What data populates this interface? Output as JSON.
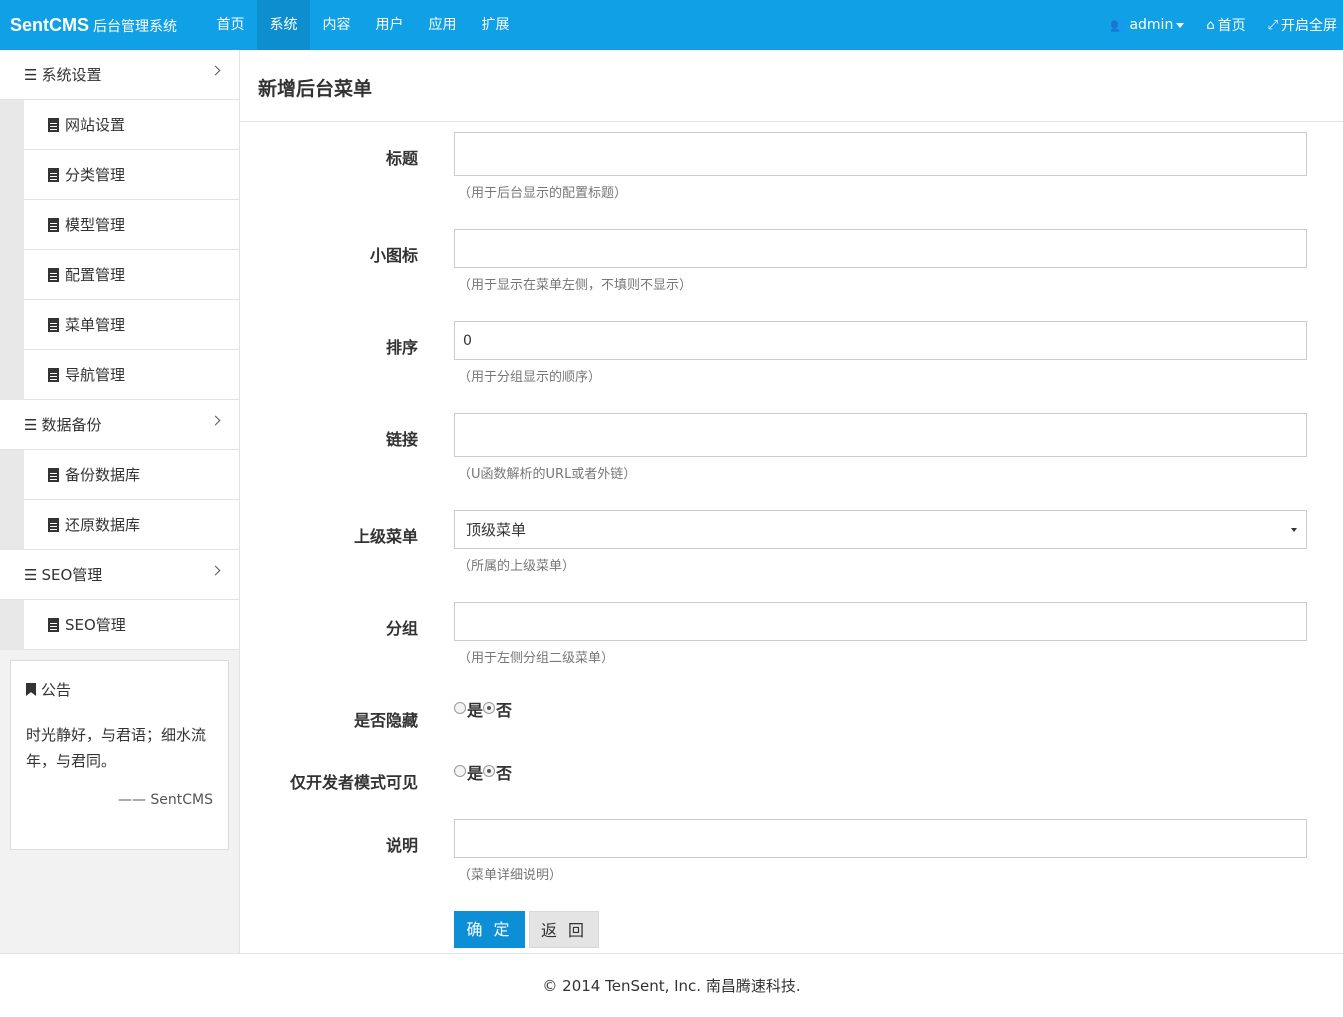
{
  "brand": {
    "name": "SentCMS",
    "subtitle": "后台管理系统"
  },
  "topnav": [
    {
      "label": "首页"
    },
    {
      "label": "系统",
      "active": true
    },
    {
      "label": "内容"
    },
    {
      "label": "用户"
    },
    {
      "label": "应用"
    },
    {
      "label": "扩展"
    }
  ],
  "topright": {
    "user": "admin",
    "home": "首页",
    "fullscreen": "开启全屏"
  },
  "sidebar": {
    "groups": [
      {
        "label": "系统设置",
        "items": [
          "网站设置",
          "分类管理",
          "模型管理",
          "配置管理",
          "菜单管理",
          "导航管理"
        ]
      },
      {
        "label": "数据备份",
        "items": [
          "备份数据库",
          "还原数据库"
        ]
      },
      {
        "label": "SEO管理",
        "items": [
          "SEO管理"
        ]
      }
    ],
    "notice": {
      "title": "公告",
      "body": "时光静好，与君语；细水流年，与君同。",
      "signature": "—— SentCMS"
    }
  },
  "page_title": "新增后台菜单",
  "form": {
    "title": {
      "label": "标题",
      "value": "",
      "hint": "（用于后台显示的配置标题）"
    },
    "icon": {
      "label": "小图标",
      "value": "",
      "hint": "（用于显示在菜单左侧，不填则不显示）"
    },
    "sort": {
      "label": "排序",
      "value": "0",
      "hint": "（用于分组显示的顺序）"
    },
    "link": {
      "label": "链接",
      "value": "",
      "hint": "（U函数解析的URL或者外链）"
    },
    "parent": {
      "label": "上级菜单",
      "value": "顶级菜单",
      "hint": "（所属的上级菜单）"
    },
    "group": {
      "label": "分组",
      "value": "",
      "hint": "（用于左侧分组二级菜单）"
    },
    "hidden": {
      "label": "是否隐藏",
      "yes": "是",
      "no": "否",
      "selected": "否"
    },
    "dev_only": {
      "label": "仅开发者模式可见",
      "yes": "是",
      "no": "否",
      "selected": "否"
    },
    "desc": {
      "label": "说明",
      "value": "",
      "hint": "（菜单详细说明）"
    },
    "submit_label": "确 定",
    "back_label": "返 回"
  },
  "footer": "© 2014 TenSent, Inc. 南昌腾速科技."
}
